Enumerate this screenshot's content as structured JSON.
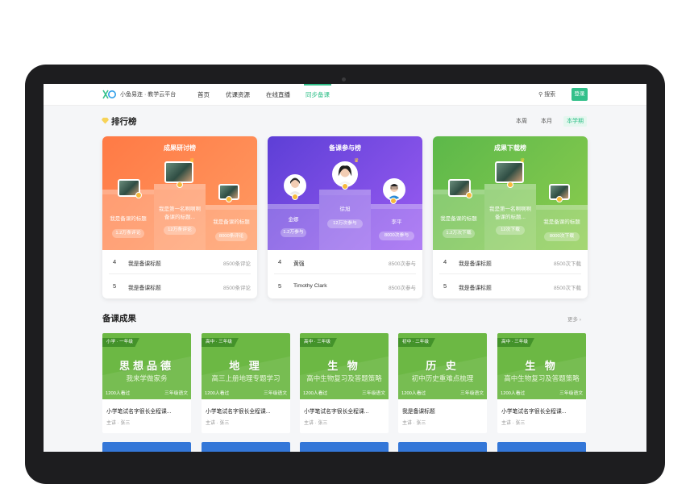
{
  "nav": {
    "brand": "小鱼易连 · 教学云平台",
    "items": [
      {
        "label": "首页",
        "active": false
      },
      {
        "label": "优课资源",
        "active": false
      },
      {
        "label": "在线直播",
        "active": false
      },
      {
        "label": "同步备课",
        "active": true
      }
    ],
    "search": "搜索",
    "login": "登录"
  },
  "ranking": {
    "title": "排行榜",
    "periods": [
      "本周",
      "本月",
      "本学期"
    ],
    "active_period": "本学期",
    "boards": [
      {
        "title": "成果研讨榜",
        "podium": [
          {
            "place": 2,
            "label": "我是备课的标题",
            "pill": "1.2万条评论"
          },
          {
            "place": 1,
            "label": "我是第一名啊啊啊备课的标题...",
            "pill": "12万条评论"
          },
          {
            "place": 3,
            "label": "我是备课的标题",
            "pill": "8000条评论"
          }
        ],
        "rows": [
          {
            "rank": "4",
            "name": "我是备课标题",
            "value": "8500条评论"
          },
          {
            "rank": "5",
            "name": "我是备课标题",
            "value": "8500条评论"
          }
        ]
      },
      {
        "title": "备课参与榜",
        "podium": [
          {
            "place": 2,
            "label": "金娜",
            "pill": "1.2万参与"
          },
          {
            "place": 1,
            "label": "徐旭",
            "pill": "12万次参与"
          },
          {
            "place": 3,
            "label": "李平",
            "pill": "8000次参与"
          }
        ],
        "rows": [
          {
            "rank": "4",
            "name": "黄强",
            "value": "8500次参与"
          },
          {
            "rank": "5",
            "name": "Timothy Clark",
            "value": "8500次参与"
          }
        ]
      },
      {
        "title": "成果下载榜",
        "podium": [
          {
            "place": 2,
            "label": "我是备课的标题",
            "pill": "1.2万次下载"
          },
          {
            "place": 1,
            "label": "我是第一名啊啊啊备课的标题...",
            "pill": "12次下载"
          },
          {
            "place": 3,
            "label": "我是备课的标题",
            "pill": "8000次下载"
          }
        ],
        "rows": [
          {
            "rank": "4",
            "name": "我是备课标题",
            "value": "8500次下载"
          },
          {
            "rank": "5",
            "name": "我是备课标题",
            "value": "8500次下载"
          }
        ]
      }
    ]
  },
  "results": {
    "title": "备课成果",
    "more": "更多 ›",
    "cards": [
      {
        "tag": "小学 · 一年级",
        "subject": "思想品德",
        "topic": "我来学做家务",
        "views": "1200人看过",
        "grade": "三年级语文",
        "name": "小学笔试名字很长全程课...",
        "author": "主讲 · 张三"
      },
      {
        "tag": "高中 · 三年级",
        "subject": "地 理",
        "topic": "高三上册地理专题学习",
        "views": "1200人看过",
        "grade": "三年级语文",
        "name": "小学笔试名字很长全程课...",
        "author": "主讲 · 张三"
      },
      {
        "tag": "高中 · 三年级",
        "subject": "生 物",
        "topic": "高中生物复习及答题策略",
        "views": "1200人看过",
        "grade": "三年级语文",
        "name": "小学笔试名字很长全程课...",
        "author": "主讲 · 张三"
      },
      {
        "tag": "初中 · 二年级",
        "subject": "历 史",
        "topic": "初中历史重难点梳理",
        "views": "1200人看过",
        "grade": "三年级语文",
        "name": "我是备课标题",
        "author": "主讲 · 张三"
      },
      {
        "tag": "高中 · 三年级",
        "subject": "生 物",
        "topic": "高中生物复习及答题策略",
        "views": "1200人看过",
        "grade": "三年级语文",
        "name": "小学笔试名字很长全程课...",
        "author": "主讲 · 张三"
      }
    ]
  }
}
